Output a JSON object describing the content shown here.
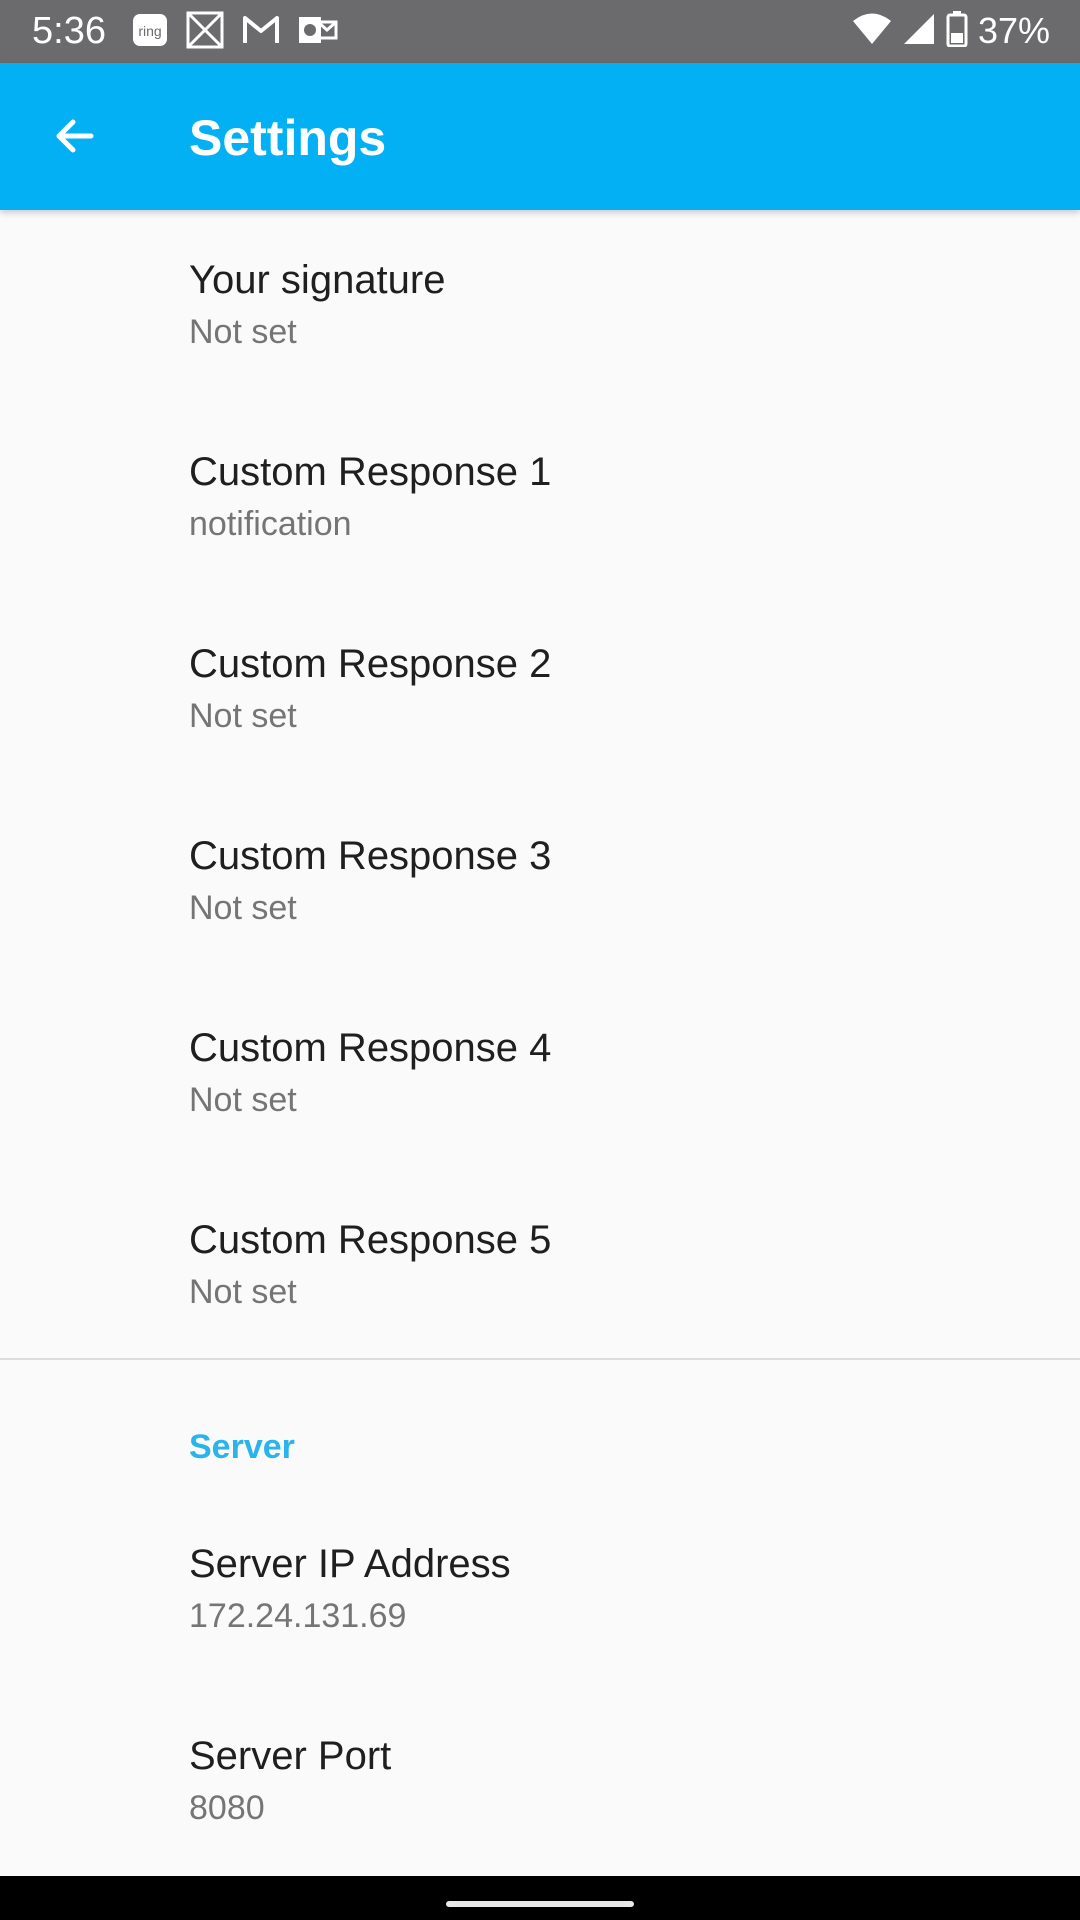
{
  "status_bar": {
    "time": "5:36",
    "battery_percent": "37%",
    "notification_icons": [
      "ring-icon",
      "image-icon",
      "gmail-icon",
      "outlook-icon"
    ],
    "system_icons": [
      "wifi-icon",
      "cell-signal-icon",
      "battery-icon"
    ]
  },
  "app_bar": {
    "title": "Settings",
    "background_color": "#03b0f4",
    "back_icon": "arrow-back-icon"
  },
  "preferences": [
    {
      "title": "Your signature",
      "summary": "Not set"
    },
    {
      "title": "Custom Response 1",
      "summary": "notification"
    },
    {
      "title": "Custom Response 2",
      "summary": "Not set"
    },
    {
      "title": "Custom Response 3",
      "summary": "Not set"
    },
    {
      "title": "Custom Response 4",
      "summary": "Not set"
    },
    {
      "title": "Custom Response 5",
      "summary": "Not set"
    }
  ],
  "server": {
    "category_title": "Server",
    "category_color": "#2ab4ea",
    "items": [
      {
        "title": "Server IP Address",
        "summary": "172.24.131.69"
      },
      {
        "title": "Server Port",
        "summary": "8080"
      }
    ]
  }
}
